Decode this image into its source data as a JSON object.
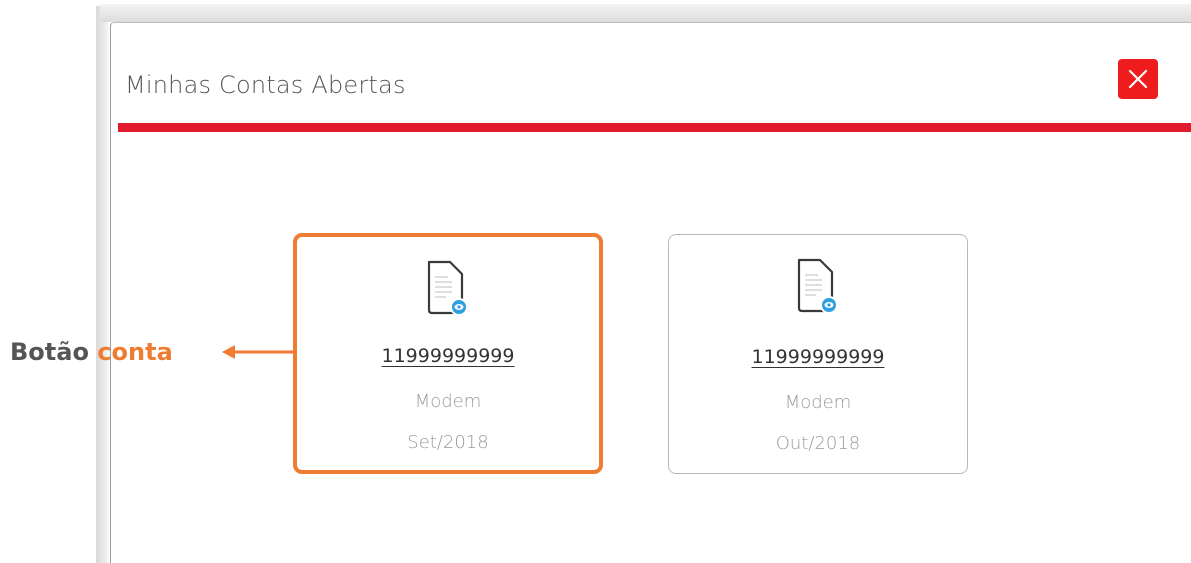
{
  "dialog": {
    "title": "Minhas Contas Abertas"
  },
  "cards": [
    {
      "number": "11999999999",
      "type": "Modem",
      "date": "Set/2018",
      "icon": "document-view-icon"
    },
    {
      "number": "11999999999",
      "type": "Modem",
      "date": "Out/2018",
      "icon": "document-view-icon"
    }
  ],
  "annotation": {
    "label": "Botão",
    "accent": "conta"
  },
  "colors": {
    "brand_red": "#e11c2f",
    "close_red": "#ee1c1c",
    "highlight_orange": "#ee7d31",
    "icon_blue": "#2f9fe0"
  }
}
